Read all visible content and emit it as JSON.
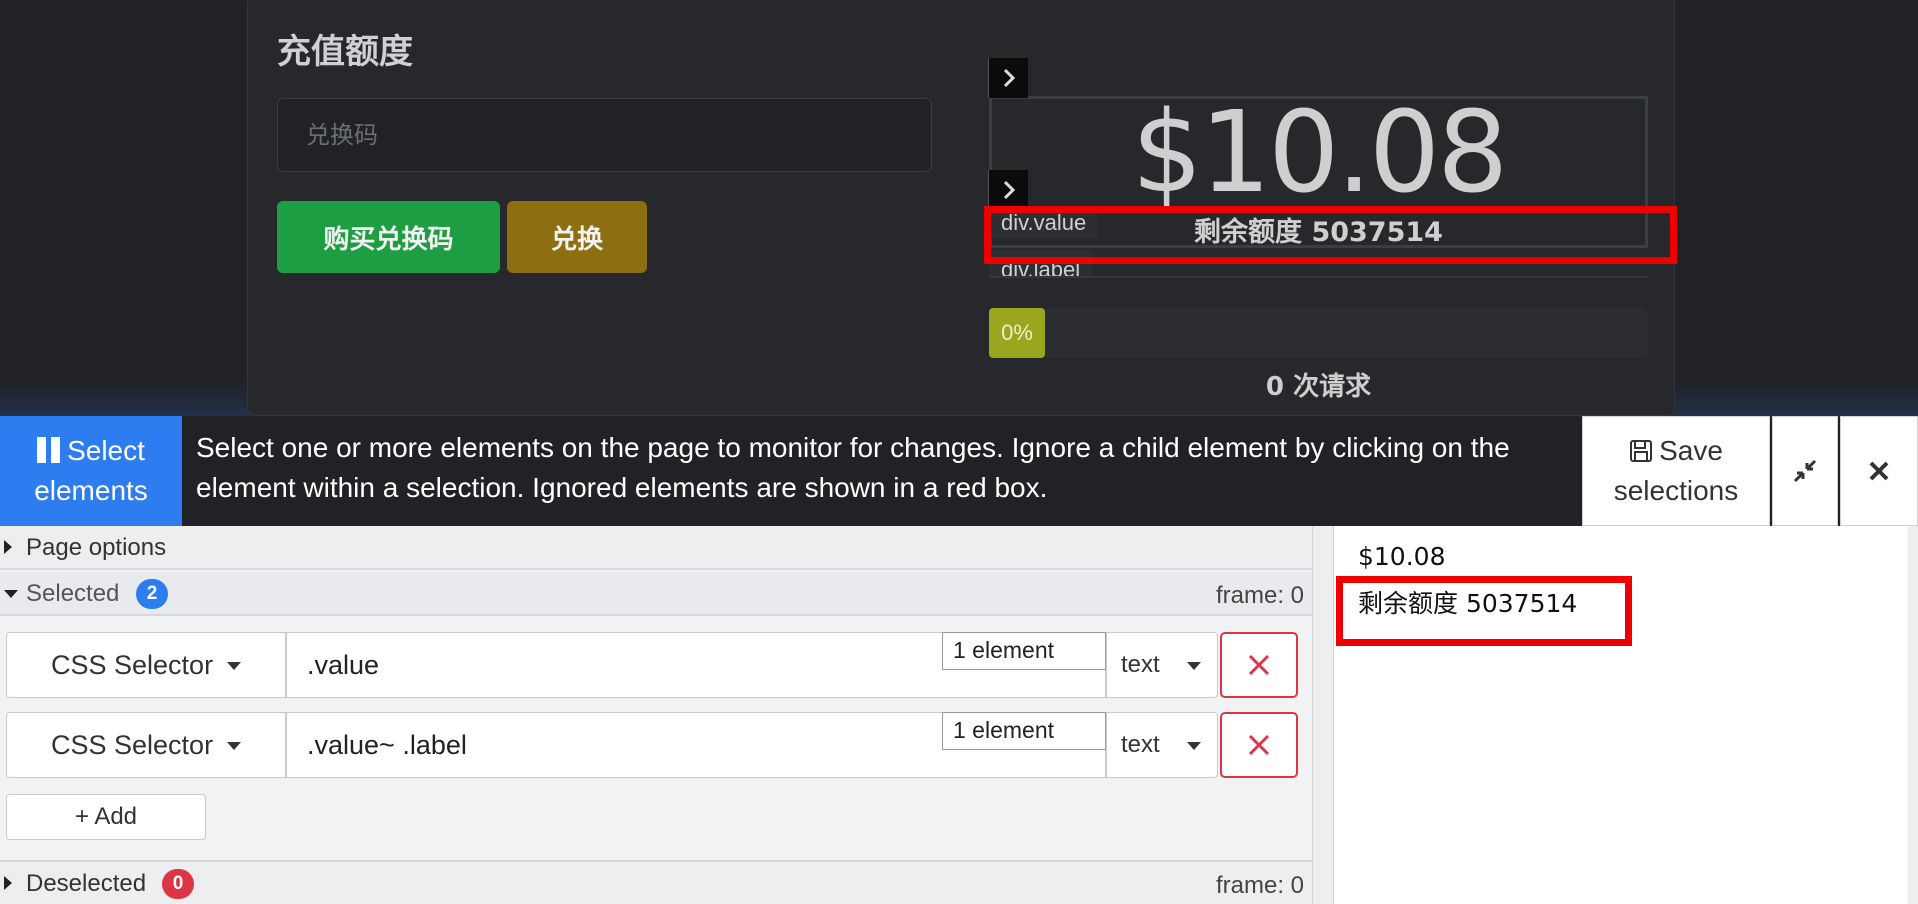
{
  "page": {
    "card_title": "充值额度",
    "redeem_placeholder": "兑换码",
    "buy_button": "购买兑换码",
    "redeem_button": "兑换",
    "balance_value": "$10.08",
    "balance_label": "剩余额度 5037514",
    "tag_value": "div.value",
    "tag_label": "div.label",
    "progress_text": "0%",
    "progress_value": 0,
    "requests_text": "0 次请求"
  },
  "toolbar": {
    "select_label": "Select elements",
    "instructions": "Select one or more elements on the page to monitor for changes. Ignore a child element by clicking on the element within a selection. Ignored elements are shown in a red box.",
    "save_label": "Save selections"
  },
  "panel": {
    "page_options_label": "Page options",
    "selected_label": "Selected",
    "selected_count": "2",
    "selected_frame": "frame: 0",
    "selectors": [
      {
        "type": "CSS Selector",
        "value": ".value",
        "count": "1 element",
        "format": "text"
      },
      {
        "type": "CSS Selector",
        "value": ".value~ .label",
        "count": "1 element",
        "format": "text"
      }
    ],
    "add_label": "+ Add",
    "deselected_label": "Deselected",
    "deselected_count": "0",
    "deselected_frame": "frame: 0"
  },
  "preview": {
    "lines": [
      "$10.08",
      "剩余额度 5037514"
    ]
  },
  "colors": {
    "primary": "#2d7df0",
    "danger": "#dc3545",
    "highlight": "#ee0000",
    "buy_green": "#1e9e43",
    "redeem_gold": "#8d6f12",
    "progress": "#9aa61e"
  }
}
